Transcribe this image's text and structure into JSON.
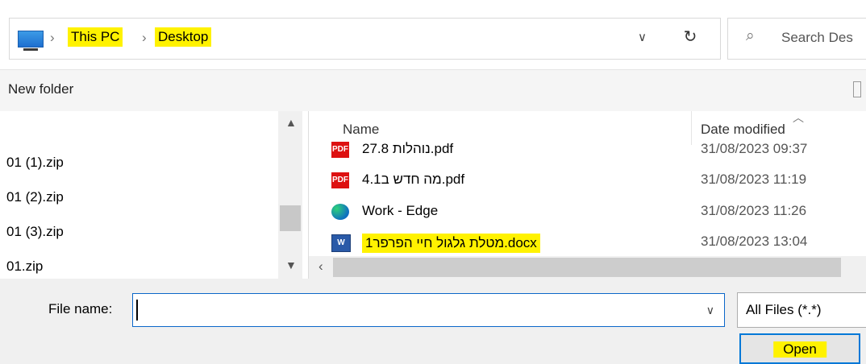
{
  "address": {
    "crumbs": [
      "This PC",
      "Desktop"
    ],
    "search_placeholder": "Search Des"
  },
  "commandbar": {
    "new_folder": "New folder"
  },
  "nav": {
    "items": [
      "01 (1).zip",
      "01 (2).zip",
      "01 (3).zip",
      "01.zip"
    ]
  },
  "file_list": {
    "header_name": "Name",
    "header_date": "Date modified",
    "rows": [
      {
        "icon": "pdf-icon",
        "name": "נוהלות 27.8.pdf",
        "date": "31/08/2023 09:37"
      },
      {
        "icon": "pdf-icon",
        "name": "מה חדש ב4.1.pdf",
        "date": "31/08/2023 11:19"
      },
      {
        "icon": "edge-shortcut-icon",
        "name": "Work - Edge",
        "date": "31/08/2023 11:26"
      },
      {
        "icon": "word-doc-icon",
        "name": "מטלת גלגול חיי הפרפר1.docx",
        "date": "31/08/2023 13:04"
      }
    ]
  },
  "bottom": {
    "file_name_label": "File name:",
    "file_name_value": "",
    "filter": "All Files (*.*)",
    "open_label": "Open"
  },
  "colors": {
    "highlight": "#fff200",
    "focus_border": "#0078d7"
  }
}
